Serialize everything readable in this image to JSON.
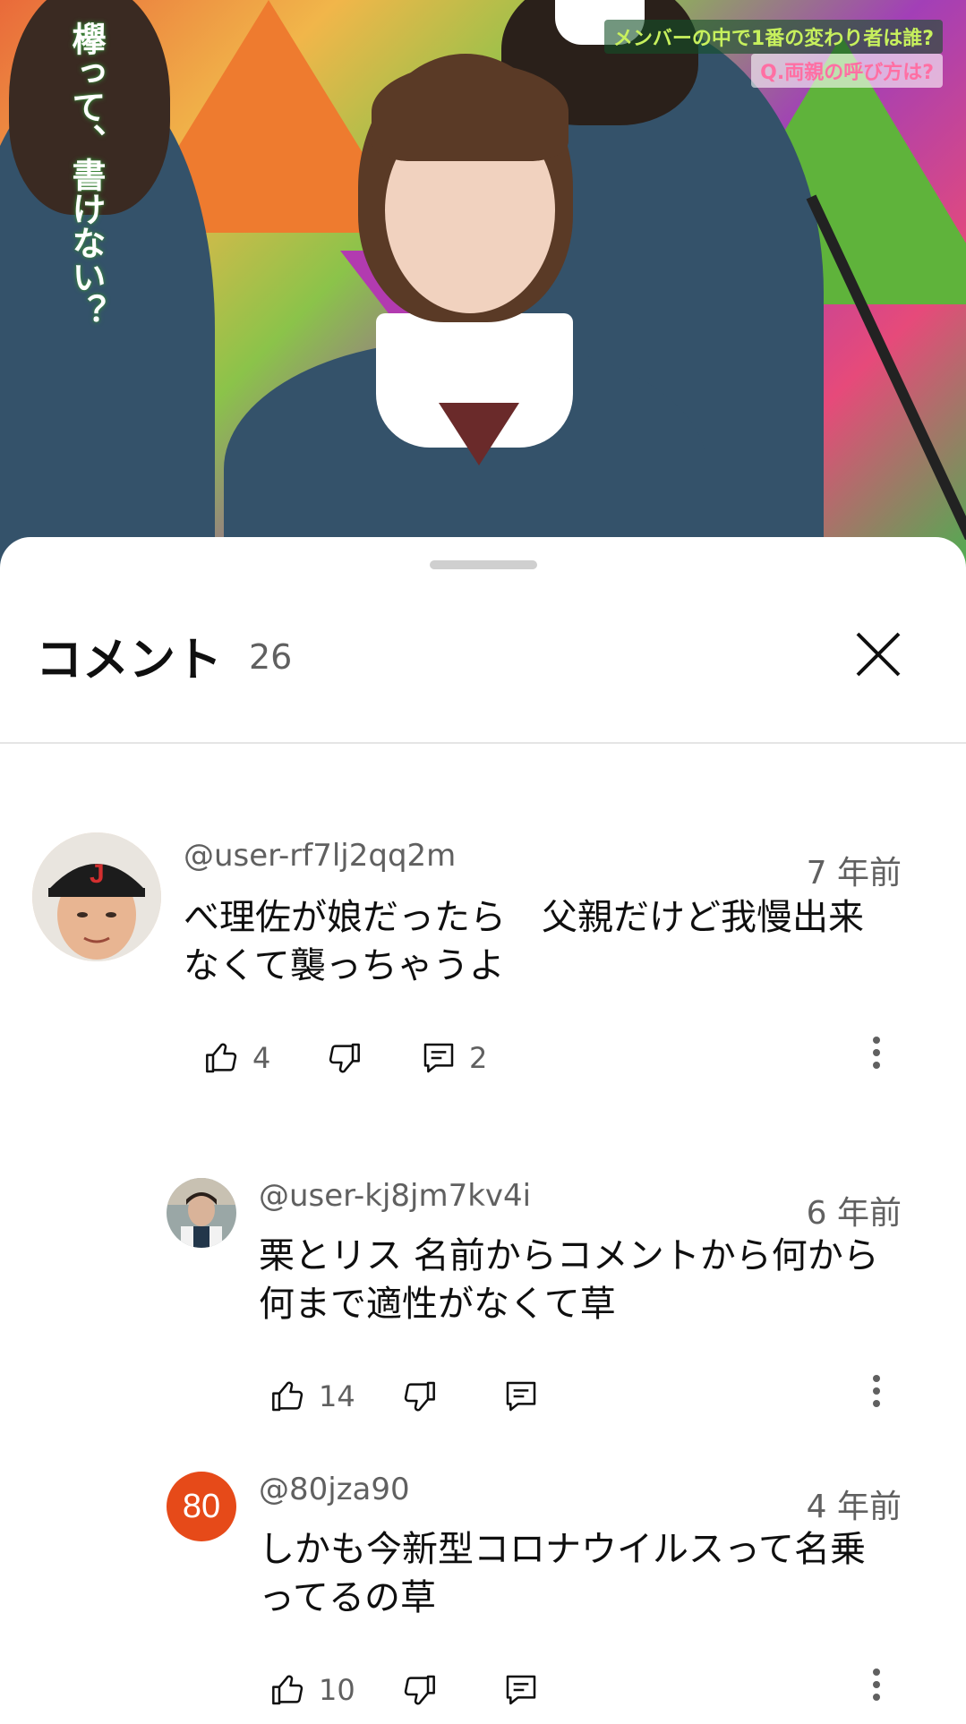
{
  "video": {
    "logo_text": "欅って、書けない？",
    "caption_main": "メンバーの中で1番の変わり者は誰?",
    "caption_question": "Q.両親の呼び方は?"
  },
  "sheet": {
    "title": "コメント",
    "count": "26",
    "close_icon": "close-icon"
  },
  "comments": [
    {
      "handle": "@user-rf7lj2qq2m",
      "age": "7 年前",
      "text_line1": "べ理佐が娘だったら　父親だけど我慢出来",
      "text_line2": "なくて襲っちゃうよ",
      "likes": "4",
      "replies": "2",
      "avatar": "photo"
    },
    {
      "handle": "@user-kj8jm7kv4i",
      "age": "6 年前",
      "text_line1": "栗とリス 名前からコメントから何から",
      "text_line2": "何まで適性がなくて草",
      "likes": "14",
      "replies": "",
      "avatar": "photo"
    },
    {
      "handle": "@80jza90",
      "age": "4 年前",
      "text_line1": "しかも今新型コロナウイルスって名乗",
      "text_line2": "ってるの草",
      "likes": "10",
      "replies": "",
      "avatar_text": "80",
      "avatar_color": "#e64a19"
    }
  ]
}
